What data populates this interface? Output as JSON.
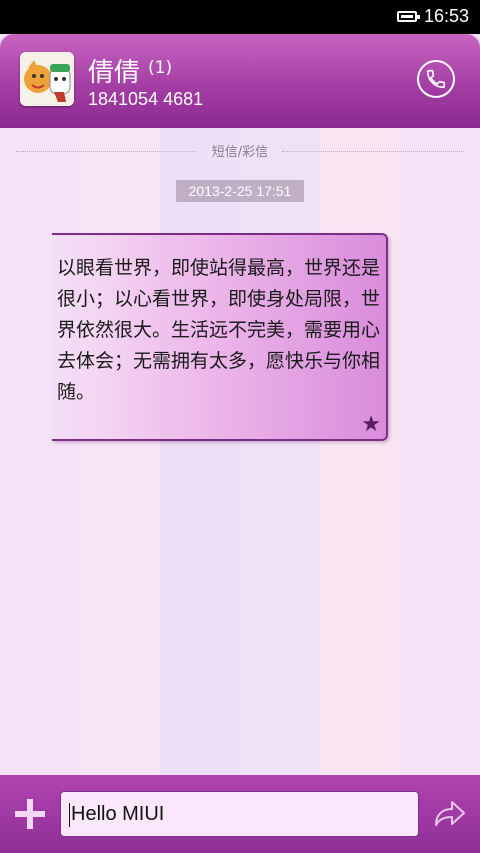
{
  "status_bar": {
    "time": "16:53",
    "icons": [
      "battery-icon"
    ]
  },
  "header": {
    "contact_name": "倩倩",
    "unread_count": "(1)",
    "phone_number": "1841054 4681",
    "call_icon": "phone-icon"
  },
  "thread": {
    "divider_label": "短信/彩信",
    "timestamp": "2013-2-25 17:51",
    "messages": [
      {
        "text": "以眼看世界，即使站得最高，世界还是很小；以心看世界，即使身处局限，世界依然很大。生活远不完美，需要用心去体会；无需拥有太多，愿快乐与你相随。",
        "starred": true
      }
    ]
  },
  "composer": {
    "add_icon": "plus-icon",
    "input_value": "Hello MIUI",
    "send_icon": "send-arrow-icon"
  },
  "colors": {
    "header": "#a43ea5",
    "bubble_dark": "#7a2f84",
    "background": "#f1e2f4"
  }
}
